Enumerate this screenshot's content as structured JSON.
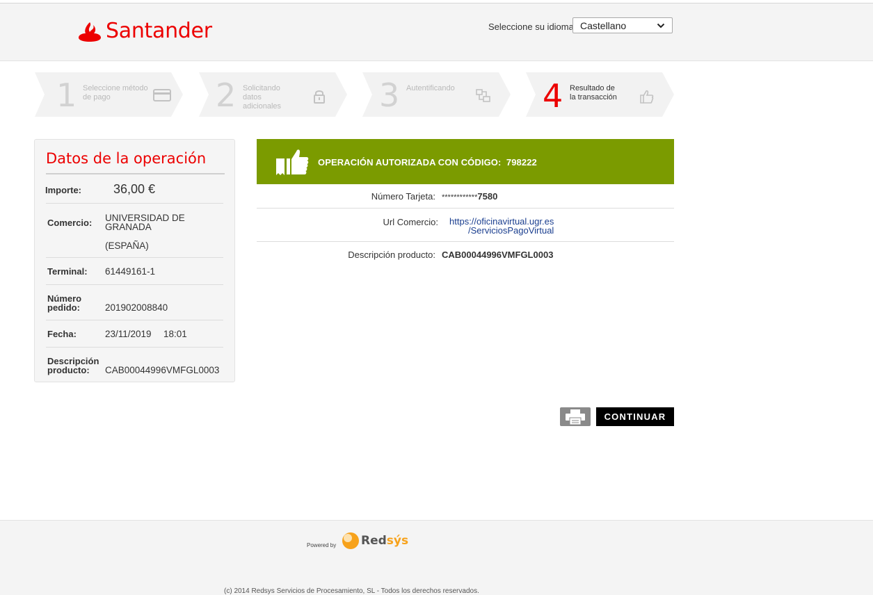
{
  "header": {
    "brand": "Santander",
    "language_label": "Seleccione su idioma",
    "language_value": "Castellano"
  },
  "steps": [
    {
      "number": "1",
      "label": "Seleccione método de pago",
      "icon": "credit-card-icon",
      "active": false
    },
    {
      "number": "2",
      "label": "Solicitando datos adicionales",
      "icon": "lock-icon",
      "active": false
    },
    {
      "number": "3",
      "label": "Autentificando",
      "icon": "authentication-icon",
      "active": false
    },
    {
      "number": "4",
      "label": "Resultado de la transacción",
      "icon": "thumbs-up-icon",
      "active": true
    }
  ],
  "operation": {
    "title": "Datos de la operación",
    "amount_label": "Importe:",
    "amount_value": "36,00 €",
    "merchant_label": "Comercio:",
    "merchant_value": "UNIVERSIDAD DE GRANADA",
    "merchant_country": "(ESPAÑA)",
    "terminal_label": "Terminal:",
    "terminal_value": "61449161-1",
    "order_label": "Número pedido:",
    "order_value": "201902008840",
    "date_label": "Fecha:",
    "date_value": "23/11/2019",
    "time_value": "18:01",
    "product_label": "Descripción producto:",
    "product_value": "CAB00044996VMFGL0003"
  },
  "result": {
    "banner_text": "OPERACIÓN AUTORIZADA CON CÓDIGO:",
    "auth_code": "798222",
    "card_label": "Número Tarjeta:",
    "card_mask": "************",
    "card_last": "7580",
    "url_label": "Url Comercio:",
    "url_line1": "https://oficinavirtual.ugr.es",
    "url_line2": "/ServiciosPagoVirtual",
    "product_label": "Descripción producto:",
    "product_value": "CAB00044996VMFGL0003"
  },
  "actions": {
    "continue_label": "CONTINUAR"
  },
  "footer": {
    "powered_by": "Powered by",
    "redsys": "Redsýs",
    "copyright": "(c) 2014 Redsys Servicios de Procesamiento, SL - Todos los derechos reservados."
  },
  "colors": {
    "brand_red": "#ec0000",
    "success_green": "#7b9b00",
    "link_blue": "#1a3e8f"
  }
}
